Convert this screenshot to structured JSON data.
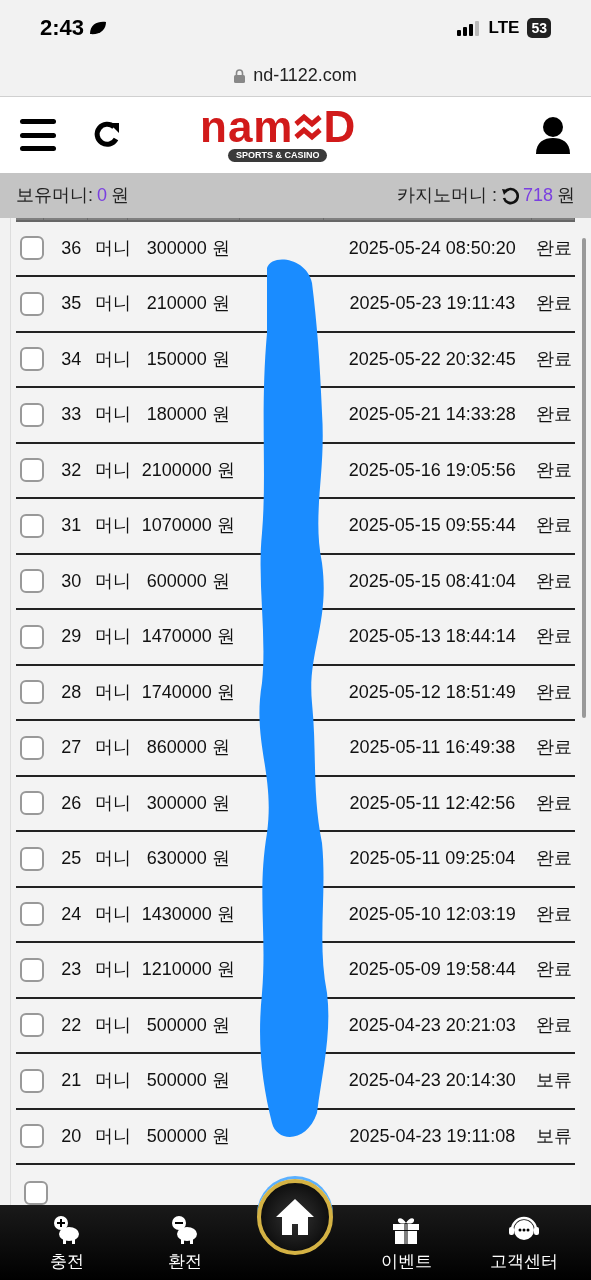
{
  "status_bar": {
    "time": "2:43",
    "network": "LTE",
    "battery": "53"
  },
  "browser": {
    "url": "nd-1122.com"
  },
  "header": {
    "logo_left": "nam",
    "logo_right": "D",
    "tagline": "SPORTS & CASINO"
  },
  "balance": {
    "label": "보유머니:",
    "value": "0",
    "unit": "원",
    "casino_label": "카지노머니 :",
    "casino_value": "718",
    "casino_unit": "원"
  },
  "rows": [
    {
      "number": "36",
      "type": "머니",
      "amount": "300000 원",
      "datetime": "2025-05-24 08:50:20",
      "status": "완료",
      "checked": false
    },
    {
      "number": "35",
      "type": "머니",
      "amount": "210000 원",
      "datetime": "2025-05-23 19:11:43",
      "status": "완료",
      "checked": false
    },
    {
      "number": "34",
      "type": "머니",
      "amount": "150000 원",
      "datetime": "2025-05-22 20:32:45",
      "status": "완료",
      "checked": false
    },
    {
      "number": "33",
      "type": "머니",
      "amount": "180000 원",
      "datetime": "2025-05-21 14:33:28",
      "status": "완료",
      "checked": false
    },
    {
      "number": "32",
      "type": "머니",
      "amount": "2100000 원",
      "datetime": "2025-05-16 19:05:56",
      "status": "완료",
      "checked": false
    },
    {
      "number": "31",
      "type": "머니",
      "amount": "1070000 원",
      "datetime": "2025-05-15 09:55:44",
      "status": "완료",
      "checked": false
    },
    {
      "number": "30",
      "type": "머니",
      "amount": "600000 원",
      "datetime": "2025-05-15 08:41:04",
      "status": "완료",
      "checked": false
    },
    {
      "number": "29",
      "type": "머니",
      "amount": "1470000 원",
      "datetime": "2025-05-13 18:44:14",
      "status": "완료",
      "checked": false
    },
    {
      "number": "28",
      "type": "머니",
      "amount": "1740000 원",
      "datetime": "2025-05-12 18:51:49",
      "status": "완료",
      "checked": false
    },
    {
      "number": "27",
      "type": "머니",
      "amount": "860000 원",
      "datetime": "2025-05-11 16:49:38",
      "status": "완료",
      "checked": false
    },
    {
      "number": "26",
      "type": "머니",
      "amount": "300000 원",
      "datetime": "2025-05-11 12:42:56",
      "status": "완료",
      "checked": false
    },
    {
      "number": "25",
      "type": "머니",
      "amount": "630000 원",
      "datetime": "2025-05-11 09:25:04",
      "status": "완료",
      "checked": false
    },
    {
      "number": "24",
      "type": "머니",
      "amount": "1430000 원",
      "datetime": "2025-05-10 12:03:19",
      "status": "완료",
      "checked": false
    },
    {
      "number": "23",
      "type": "머니",
      "amount": "1210000 원",
      "datetime": "2025-05-09 19:58:44",
      "status": "완료",
      "checked": false
    },
    {
      "number": "22",
      "type": "머니",
      "amount": "500000 원",
      "datetime": "2025-04-23 20:21:03",
      "status": "완료",
      "checked": false
    },
    {
      "number": "21",
      "type": "머니",
      "amount": "500000 원",
      "datetime": "2025-04-23 20:14:30",
      "status": "보류",
      "checked": false
    },
    {
      "number": "20",
      "type": "머니",
      "amount": "500000 원",
      "datetime": "2025-04-23 19:11:08",
      "status": "보류",
      "checked": false
    }
  ],
  "partial_row": {
    "checked": false
  },
  "bottom_nav": [
    {
      "kind": "deposit",
      "label": "충전"
    },
    {
      "kind": "withdraw",
      "label": "환전"
    },
    {
      "kind": "home"
    },
    {
      "kind": "event",
      "label": "이벤트"
    },
    {
      "kind": "support",
      "label": "고객센터"
    }
  ]
}
